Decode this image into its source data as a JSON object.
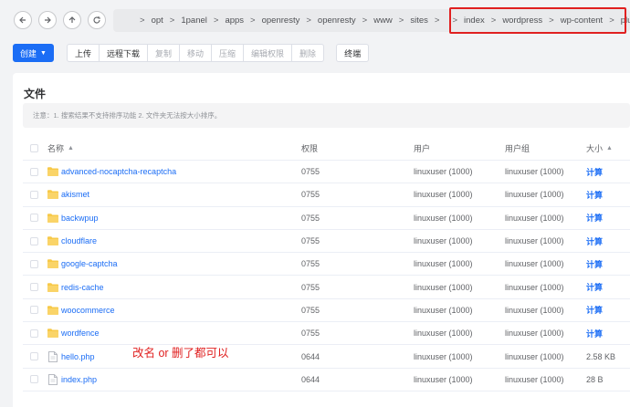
{
  "nav": {
    "breadcrumb": [
      "opt",
      "1panel",
      "apps",
      "openresty",
      "openresty",
      "www",
      "sites",
      "index",
      "wordpress",
      "wp-content",
      "plugins"
    ]
  },
  "toolbar": {
    "create_label": "创建",
    "upload_label": "上传",
    "remote_download_label": "远程下载",
    "copy_label": "复制",
    "move_label": "移动",
    "compress_label": "压缩",
    "edit_permission_label": "编辑权限",
    "delete_label": "删除",
    "terminal_label": "终端"
  },
  "card": {
    "title": "文件",
    "notice": "注意：1. 搜索结果不支持排序功能 2. 文件夹无法按大小排序。"
  },
  "table": {
    "headers": {
      "name": "名称",
      "permission": "权限",
      "user": "用户",
      "group": "用户组",
      "size": "大小"
    },
    "rows": [
      {
        "name": "advanced-nocaptcha-recaptcha",
        "type": "folder",
        "permission": "0755",
        "user": "linuxuser (1000)",
        "group": "linuxuser (1000)",
        "size": "计算"
      },
      {
        "name": "akismet",
        "type": "folder",
        "permission": "0755",
        "user": "linuxuser (1000)",
        "group": "linuxuser (1000)",
        "size": "计算"
      },
      {
        "name": "backwpup",
        "type": "folder",
        "permission": "0755",
        "user": "linuxuser (1000)",
        "group": "linuxuser (1000)",
        "size": "计算"
      },
      {
        "name": "cloudflare",
        "type": "folder",
        "permission": "0755",
        "user": "linuxuser (1000)",
        "group": "linuxuser (1000)",
        "size": "计算"
      },
      {
        "name": "google-captcha",
        "type": "folder",
        "permission": "0755",
        "user": "linuxuser (1000)",
        "group": "linuxuser (1000)",
        "size": "计算"
      },
      {
        "name": "redis-cache",
        "type": "folder",
        "permission": "0755",
        "user": "linuxuser (1000)",
        "group": "linuxuser (1000)",
        "size": "计算"
      },
      {
        "name": "woocommerce",
        "type": "folder",
        "permission": "0755",
        "user": "linuxuser (1000)",
        "group": "linuxuser (1000)",
        "size": "计算"
      },
      {
        "name": "wordfence",
        "type": "folder",
        "permission": "0755",
        "user": "linuxuser (1000)",
        "group": "linuxuser (1000)",
        "size": "计算"
      },
      {
        "name": "hello.php",
        "type": "file",
        "permission": "0644",
        "user": "linuxuser (1000)",
        "group": "linuxuser (1000)",
        "size": "2.58 KB"
      },
      {
        "name": "index.php",
        "type": "file",
        "permission": "0644",
        "user": "linuxuser (1000)",
        "group": "linuxuser (1000)",
        "size": "28 B"
      }
    ]
  },
  "annotation": "改名 or 删了都可以",
  "colors": {
    "primary": "#1b6df5",
    "highlight_box": "#e02020",
    "folder": "#f7c948"
  }
}
